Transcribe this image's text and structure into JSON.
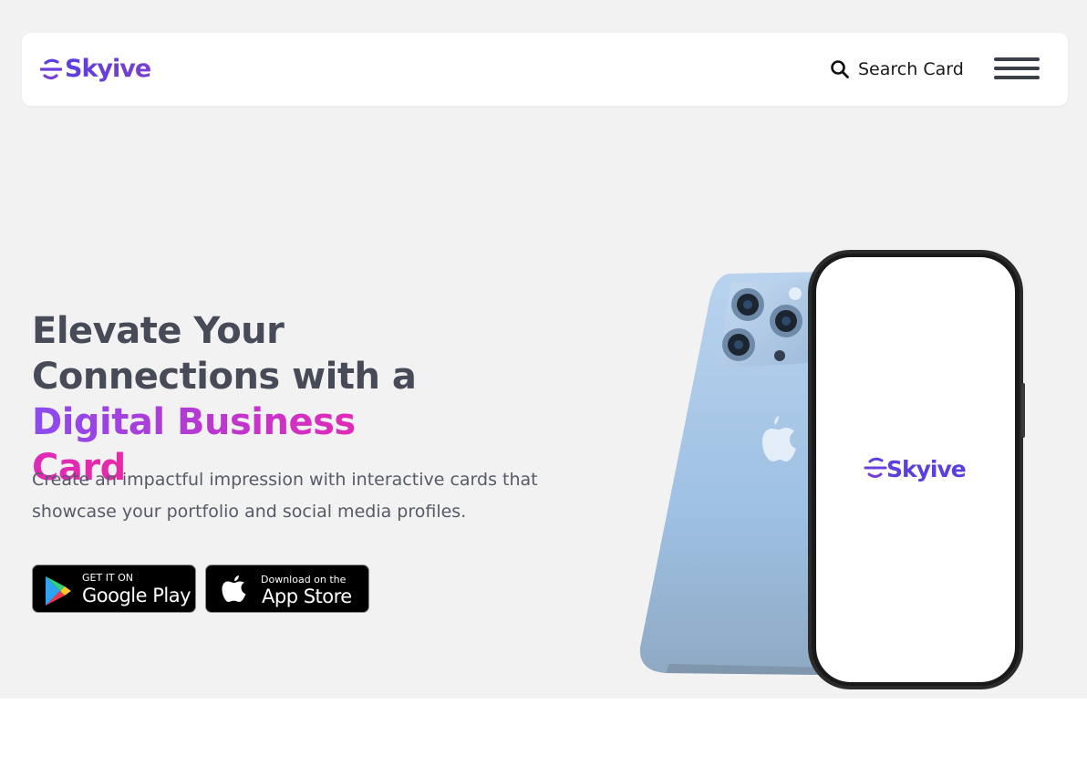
{
  "brand": {
    "name": "Skyive",
    "accent": "#5b3fe0"
  },
  "nav": {
    "search_label": "Search Card",
    "search_icon": "search-icon",
    "menu_icon": "hamburger-menu-icon"
  },
  "hero": {
    "headline_part1": "Elevate Your Connections with a ",
    "headline_highlight_a": "Digital Business",
    "headline_highlight_b": "Card",
    "subtitle": "Create an impactful impression with interactive cards that showcase your portfolio and social media profiles.",
    "gradient_colors": [
      "#8a4bf0",
      "#b13bd6",
      "#e22ab8"
    ]
  },
  "stores": {
    "google_small": "GET IT ON",
    "google_big": "Google Play",
    "apple_small": "Download on the",
    "apple_big": "App Store"
  },
  "phone_screen": {
    "logo_text": "Skyive"
  }
}
